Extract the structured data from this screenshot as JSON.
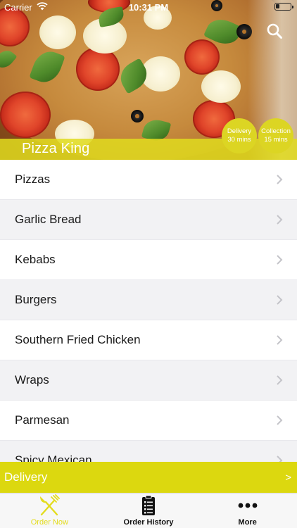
{
  "status_bar": {
    "carrier": "Carrier",
    "time": "10:31 PM"
  },
  "hero": {
    "restaurant_name": "Pizza King",
    "delivery_badge": {
      "line1": "Delivery",
      "line2": "30 mins"
    },
    "collection_badge": {
      "line1": "Collection",
      "line2": "15 mins"
    },
    "search_icon": "search-icon"
  },
  "menu": {
    "categories": [
      {
        "label": "Pizzas"
      },
      {
        "label": "Garlic Bread"
      },
      {
        "label": "Kebabs"
      },
      {
        "label": "Burgers"
      },
      {
        "label": "Southern Fried Chicken"
      },
      {
        "label": "Wraps"
      },
      {
        "label": "Parmesan"
      },
      {
        "label": "Spicy Mexican"
      }
    ]
  },
  "delivery_bar": {
    "label": "Delivery",
    "arrow": ">"
  },
  "tab_bar": {
    "tabs": [
      {
        "label": "Order Now",
        "icon": "fork-knife-icon",
        "active": true
      },
      {
        "label": "Order History",
        "icon": "receipt-list-icon",
        "active": false
      },
      {
        "label": "More",
        "icon": "more-dots-icon",
        "active": false
      }
    ]
  },
  "colors": {
    "accent_yellow": "#dcd80f",
    "badge_yellow": "#dcd523",
    "active_tab": "#e3dc1e",
    "row_alt": "#f2f2f4"
  }
}
